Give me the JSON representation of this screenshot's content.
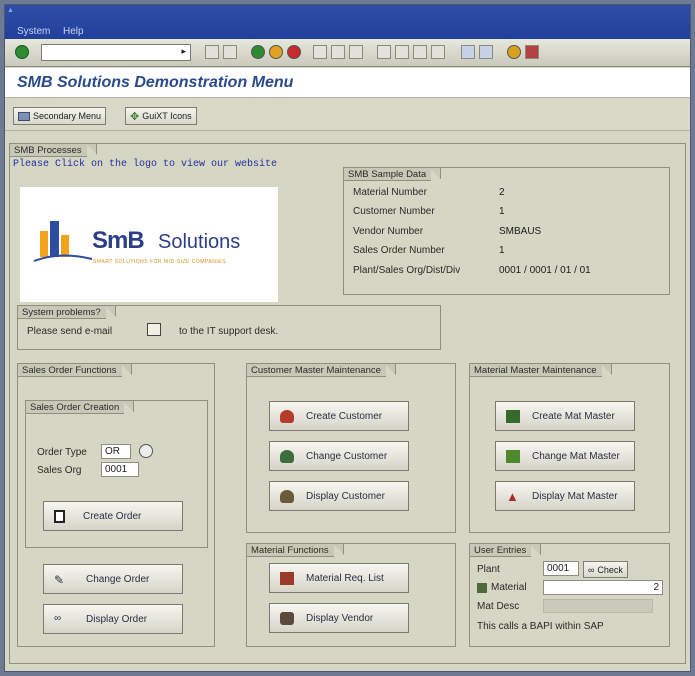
{
  "menubar": {
    "system_label": "System",
    "help_label": "Help"
  },
  "title": "SMB Solutions Demonstration Menu",
  "appbar": {
    "secondary_menu": "Secondary Menu",
    "guixt_icons": "GuiXT Icons"
  },
  "smb_processes": {
    "title": "SMB Processes",
    "logo_hint": "Please Click on the logo to view our website",
    "logo": {
      "brand": "SmB",
      "word": "Solutions",
      "tagline": "SMART SOLUTIONS FOR MID-SIZE COMPANIES"
    }
  },
  "sample_data": {
    "title": "SMB Sample Data",
    "rows": [
      {
        "label": "Material Number",
        "value": "2"
      },
      {
        "label": "Customer Number",
        "value": "1"
      },
      {
        "label": "Vendor Number",
        "value": "SMBAUS"
      },
      {
        "label": "Sales Order Number",
        "value": "1"
      },
      {
        "label": "Plant/Sales Org/Dist/Div",
        "value": "0001 / 0001 / 01 / 01"
      }
    ]
  },
  "system_problems": {
    "title": "System problems?",
    "text_before": "Please send e-mail",
    "text_after": "to the IT support desk."
  },
  "sales_order": {
    "title": "Sales Order Functions",
    "creation_title": "Sales Order Creation",
    "order_type_label": "Order Type",
    "order_type_value": "OR",
    "sales_org_label": "Sales Org",
    "sales_org_value": "0001",
    "create": "Create Order",
    "change": "Change Order",
    "display": "Display Order"
  },
  "customer_master": {
    "title": "Customer Master Maintenance",
    "create": "Create Customer",
    "change": "Change Customer",
    "display": "Display Customer"
  },
  "material_master": {
    "title": "Material Master Maintenance",
    "create": "Create Mat Master",
    "change": "Change Mat Master",
    "display": "Display Mat Master"
  },
  "material_functions": {
    "title": "Material Functions",
    "req_list": "Material Req. List",
    "display_vendor": "Display Vendor"
  },
  "user_entries": {
    "title": "User Entries",
    "plant_label": "Plant",
    "plant_value": "0001",
    "check": "Check",
    "material_label": "Material",
    "material_value": "2",
    "matdesc_label": "Mat Desc",
    "note": "This calls a BAPI within SAP"
  }
}
